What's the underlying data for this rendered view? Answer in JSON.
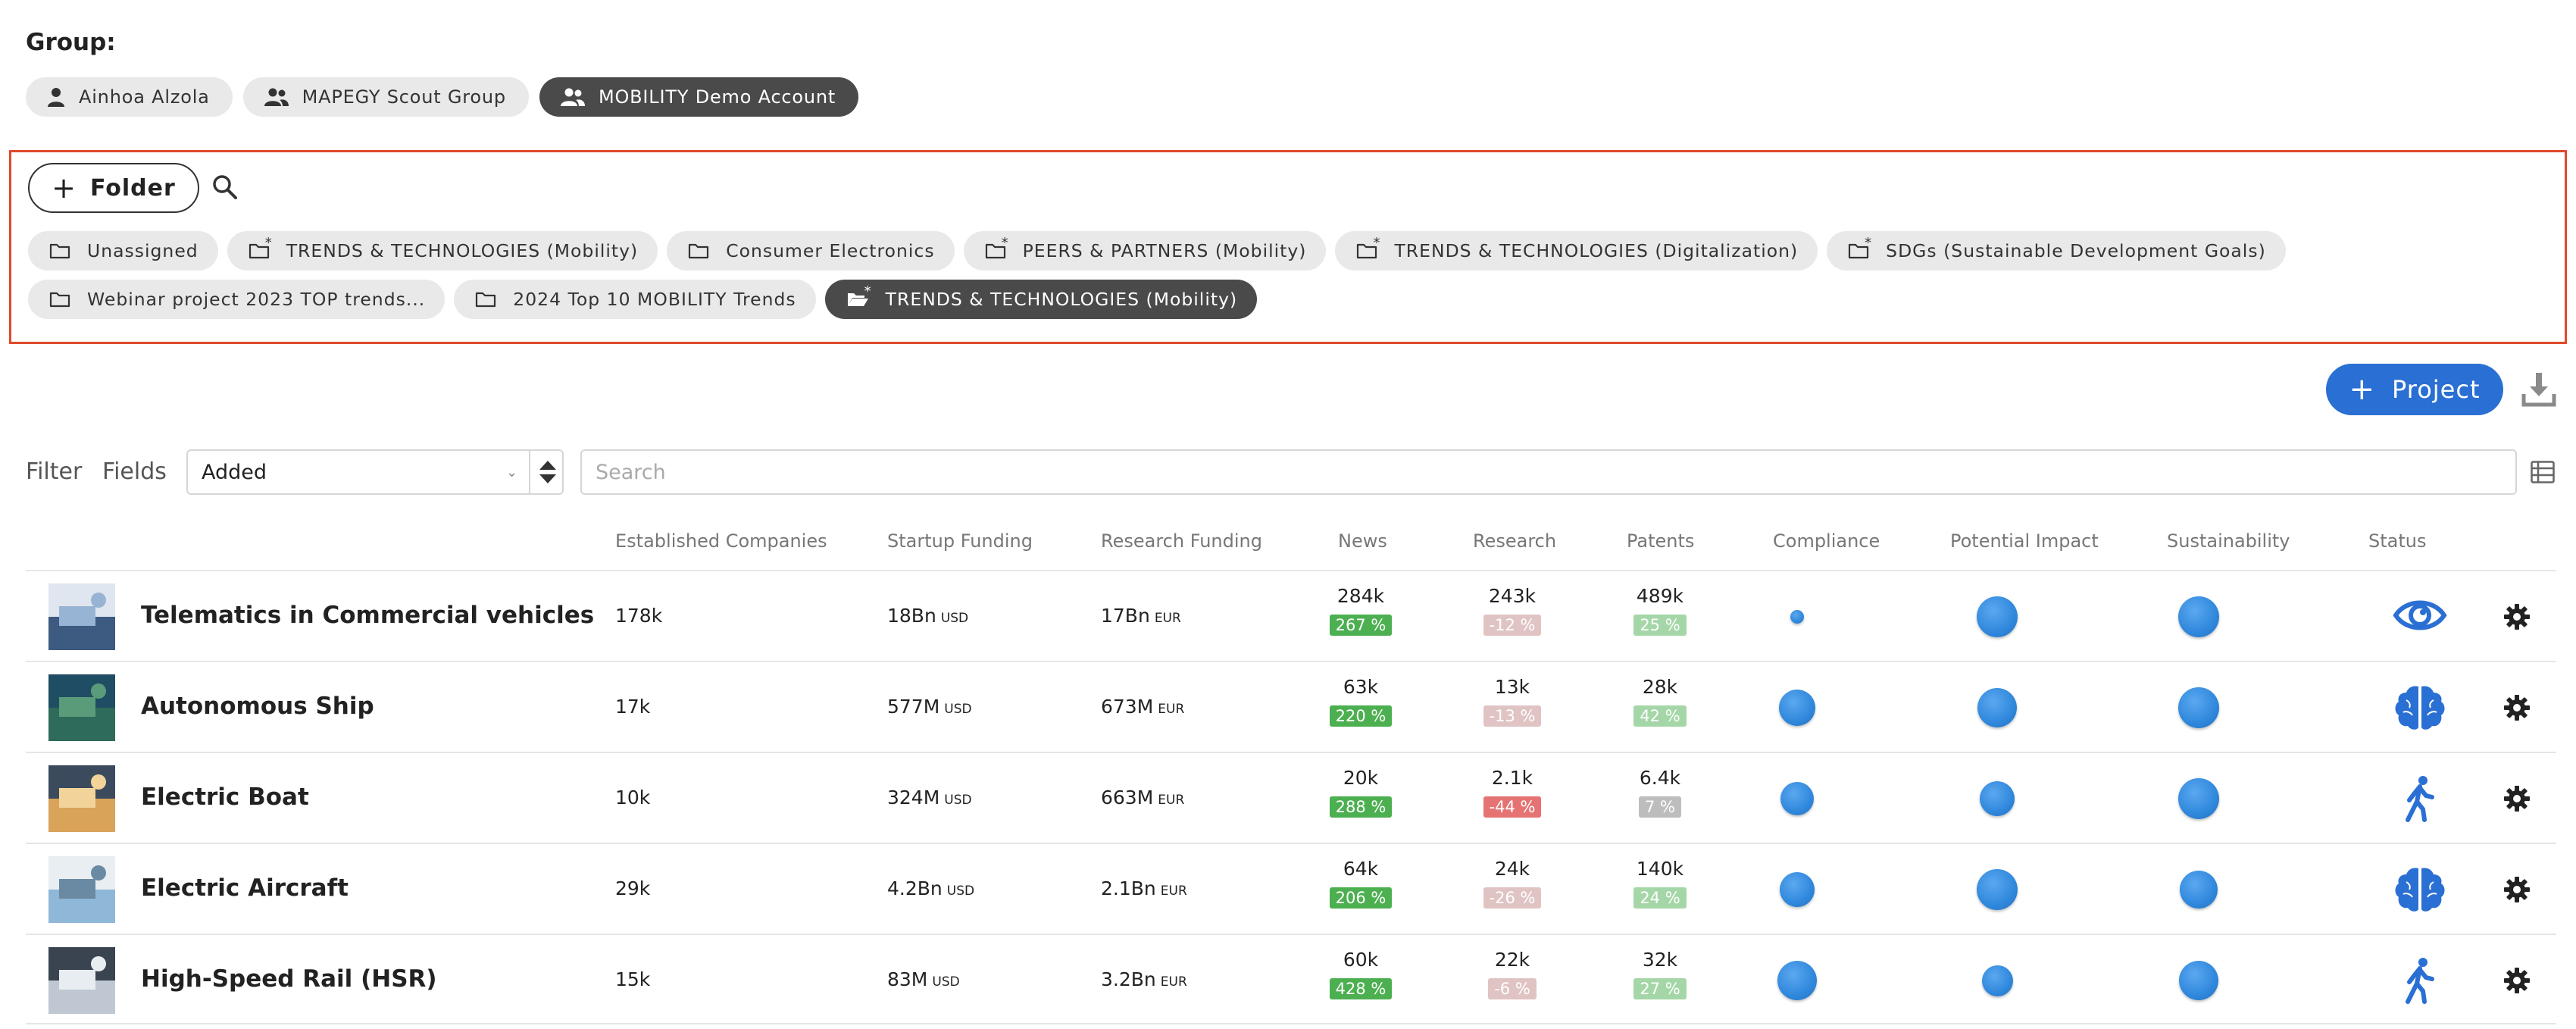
{
  "group": {
    "label": "Group:",
    "chips": [
      {
        "label": "Ainhoa Alzola",
        "icon": "user-icon",
        "active": false
      },
      {
        "label": "MAPEGY Scout Group",
        "icon": "users-icon",
        "active": false
      },
      {
        "label": "MOBILITY Demo Account",
        "icon": "users-icon",
        "active": true
      }
    ]
  },
  "folders": {
    "add_label": "Folder",
    "chips": [
      {
        "label": "Unassigned",
        "shared": false,
        "active": false
      },
      {
        "label": "TRENDS & TECHNOLOGIES (Mobility)",
        "shared": true,
        "active": false
      },
      {
        "label": "Consumer Electronics",
        "shared": false,
        "active": false
      },
      {
        "label": "PEERS & PARTNERS (Mobility)",
        "shared": true,
        "active": false
      },
      {
        "label": "TRENDS & TECHNOLOGIES (Digitalization)",
        "shared": true,
        "active": false
      },
      {
        "label": "SDGs (Sustainable Development Goals)",
        "shared": true,
        "active": false
      },
      {
        "label": "Webinar project 2023 TOP trends...",
        "shared": false,
        "active": false
      },
      {
        "label": "2024 Top 10 MOBILITY Trends",
        "shared": false,
        "active": false
      },
      {
        "label": "TRENDS & TECHNOLOGIES (Mobility)",
        "shared": true,
        "active": true
      }
    ]
  },
  "toolbar": {
    "project_label": "Project",
    "filter_label": "Filter",
    "fields_label": "Fields",
    "sort_value": "Added",
    "search_placeholder": "Search"
  },
  "table": {
    "headers": {
      "established": "Established Companies",
      "startup": "Startup Funding",
      "research_funding": "Research Funding",
      "news": "News",
      "research": "Research",
      "patents": "Patents",
      "compliance": "Compliance",
      "impact": "Potential Impact",
      "sustainability": "Sustainability",
      "status": "Status"
    },
    "rows": [
      {
        "name": "Telematics in Commercial vehicles",
        "established": "178k",
        "startup": "18Bn",
        "startup_unit": "USD",
        "research_funding": "17Bn",
        "research_funding_unit": "EUR",
        "news": "284k",
        "news_growth": "267 %",
        "research": "243k",
        "research_growth": "-12 %",
        "patents": "489k",
        "patents_growth": "25 %",
        "compliance_level": 0.15,
        "impact_level": 1.0,
        "sustainability_level": 1.0,
        "status": "eye-icon"
      },
      {
        "name": "Autonomous Ship",
        "established": "17k",
        "startup": "577M",
        "startup_unit": "USD",
        "research_funding": "673M",
        "research_funding_unit": "EUR",
        "news": "63k",
        "news_growth": "220 %",
        "research": "13k",
        "research_growth": "-13 %",
        "patents": "28k",
        "patents_growth": "42 %",
        "compliance_level": 0.85,
        "impact_level": 0.95,
        "sustainability_level": 1.0,
        "status": "brain-icon"
      },
      {
        "name": "Electric Boat",
        "established": "10k",
        "startup": "324M",
        "startup_unit": "USD",
        "research_funding": "663M",
        "research_funding_unit": "EUR",
        "news": "20k",
        "news_growth": "288 %",
        "research": "2.1k",
        "research_growth": "-44 %",
        "patents": "6.4k",
        "patents_growth": "7 %",
        "compliance_level": 0.75,
        "impact_level": 0.8,
        "sustainability_level": 1.0,
        "status": "walking-person-icon"
      },
      {
        "name": "Electric Aircraft",
        "established": "29k",
        "startup": "4.2Bn",
        "startup_unit": "USD",
        "research_funding": "2.1Bn",
        "research_funding_unit": "EUR",
        "news": "64k",
        "news_growth": "206 %",
        "research": "24k",
        "research_growth": "-26 %",
        "patents": "140k",
        "patents_growth": "24 %",
        "compliance_level": 0.8,
        "impact_level": 1.0,
        "sustainability_level": 0.9,
        "status": "brain-icon"
      },
      {
        "name": "High-Speed Rail (HSR)",
        "established": "15k",
        "startup": "83M",
        "startup_unit": "USD",
        "research_funding": "3.2Bn",
        "research_funding_unit": "EUR",
        "news": "60k",
        "news_growth": "428 %",
        "research": "22k",
        "research_growth": "-6 %",
        "patents": "32k",
        "patents_growth": "27 %",
        "compliance_level": 0.95,
        "impact_level": 0.7,
        "sustainability_level": 0.95,
        "status": "walking-person-icon"
      }
    ]
  },
  "colors": {
    "accent": "#2a6fd3",
    "active_chip": "#4a4a4a",
    "highlight_border": "#e04a2c",
    "growth_strong": "#4caf50",
    "growth_light": "#a5d6a7",
    "decline_strong": "#e57373",
    "decline_light": "#e0c4c4",
    "neutral": "#bdbdbd"
  }
}
